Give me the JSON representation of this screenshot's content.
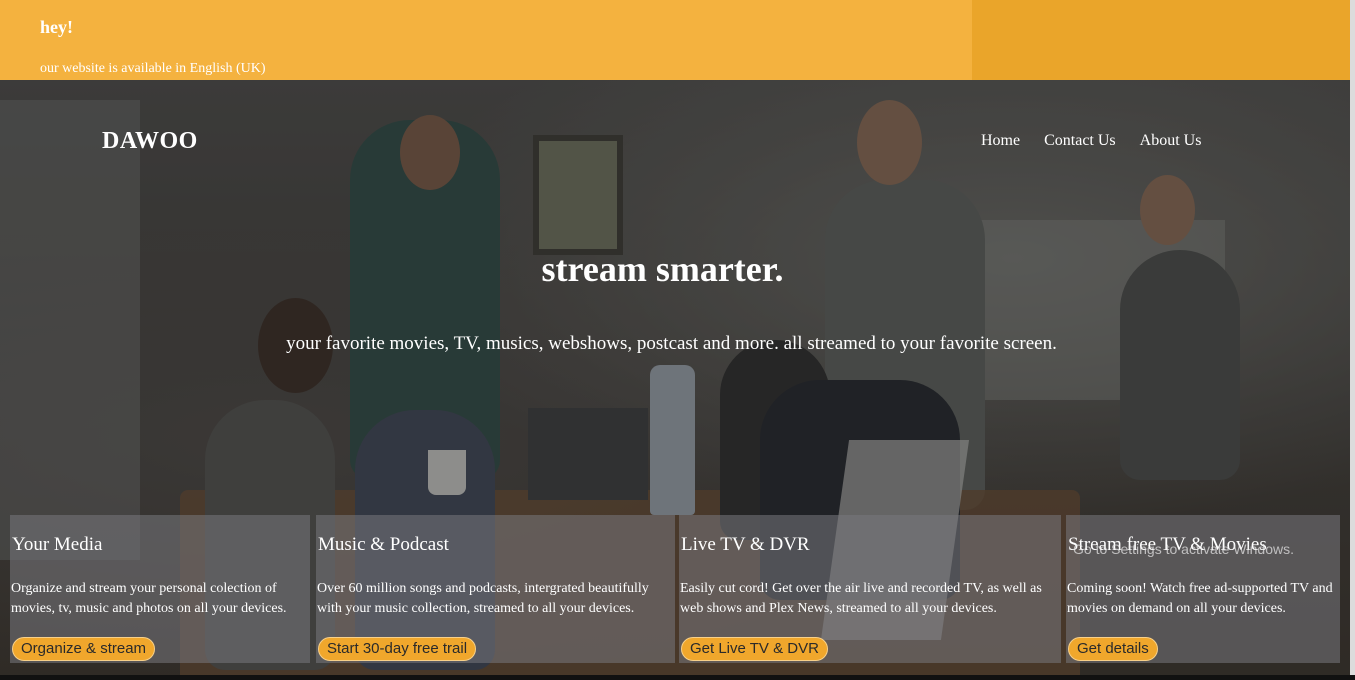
{
  "banner": {
    "heading": "hey!",
    "text": "our website is available in English (UK)"
  },
  "header": {
    "logo": "DAWOO",
    "nav": [
      {
        "label": "Home"
      },
      {
        "label": "Contact Us"
      },
      {
        "label": "About Us"
      }
    ]
  },
  "hero": {
    "title": "stream smarter.",
    "subtitle": "your favorite movies, TV, musics, webshows, postcast and more. all streamed to your favorite screen."
  },
  "cards": [
    {
      "title": "Your Media",
      "text": "Organize and stream your personal colection of movies, tv, music and photos on all your devices.",
      "button": "Organize & stream"
    },
    {
      "title": "Music & Podcast",
      "text": "Over 60 million songs and podcasts, intergrated beautifully with your music collection, streamed to all your devices.",
      "button": "Start 30-day free trail"
    },
    {
      "title": "Live TV & DVR",
      "text": "Easily cut cord! Get over the air live and recorded TV, as well as web shows and Plex News, streamed to all your devices.",
      "button": "Get Live TV & DVR"
    },
    {
      "title": "Stream free TV & Movies",
      "text": "Coming soon! Watch free ad-supported TV and movies on demand on all your devices.",
      "button": "Get details"
    }
  ],
  "os_watermark": "Go to Settings to activate Windows.",
  "colors": {
    "banner": "#f4b23f",
    "button": "#f0a72c"
  }
}
